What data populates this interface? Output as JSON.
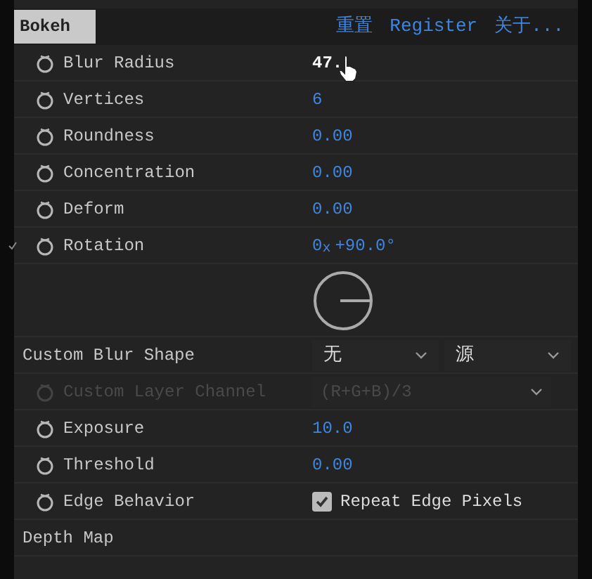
{
  "effect": {
    "title": "Bokeh",
    "selected": true,
    "links": [
      "重置",
      "Register",
      "关于..."
    ]
  },
  "params": [
    {
      "kind": "number",
      "label": "Blur Radius",
      "value": "47.",
      "active": true
    },
    {
      "kind": "number",
      "label": "Vertices",
      "value": "6",
      "active": false
    },
    {
      "kind": "number",
      "label": "Roundness",
      "value": "0.00",
      "active": false
    },
    {
      "kind": "number",
      "label": "Concentration",
      "value": "0.00",
      "active": false
    },
    {
      "kind": "number",
      "label": "Deform",
      "value": "0.00",
      "active": false
    },
    {
      "kind": "angle",
      "label": "Rotation",
      "revolutions": "0",
      "unit": "x",
      "angle": "+90.0°",
      "expanded": true
    },
    {
      "kind": "dropdowns",
      "label": "Custom Blur Shape",
      "options": [
        "无",
        "源"
      ]
    },
    {
      "kind": "dropdown",
      "label": "Custom Layer Channel",
      "value": "(R+G+B)/3",
      "disabled": true
    },
    {
      "kind": "number",
      "label": "Exposure",
      "value": "10.0",
      "active": false
    },
    {
      "kind": "number",
      "label": "Threshold",
      "value": "0.00",
      "active": false
    },
    {
      "kind": "checkbox",
      "label": "Edge Behavior",
      "option": "Repeat Edge Pixels",
      "checked": true
    },
    {
      "kind": "group",
      "label": "Depth Map"
    }
  ]
}
